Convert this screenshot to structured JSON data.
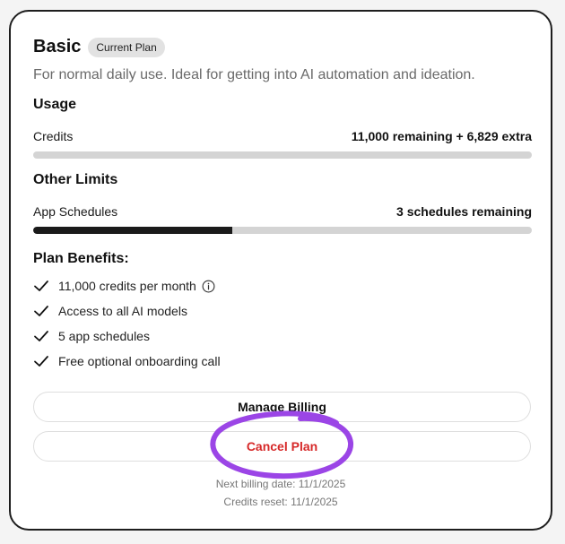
{
  "plan": {
    "name": "Basic",
    "badge": "Current Plan",
    "description": "For normal daily use. Ideal for getting into AI automation and ideation."
  },
  "usage": {
    "heading": "Usage",
    "label": "Credits",
    "value": "11,000 remaining + 6,829 extra",
    "used_fraction": 0
  },
  "other_limits": {
    "heading": "Other Limits",
    "label": "App Schedules",
    "value": "3 schedules remaining",
    "used_fraction": 0.4
  },
  "benefits": {
    "heading": "Plan Benefits:",
    "items": [
      "11,000 credits per month",
      "Access to all AI models",
      "5 app schedules",
      "Free optional onboarding call"
    ]
  },
  "buttons": {
    "manage_billing": "Manage Billing",
    "cancel_plan": "Cancel Plan"
  },
  "footer": {
    "next_billing": "Next billing date: 11/1/2025",
    "credits_reset": "Credits reset: 11/1/2025"
  },
  "colors": {
    "cancel_text": "#d62828",
    "highlight_circle": "#9b45e6",
    "bar_fill": "#1a1a1a",
    "bar_track": "#d4d4d4"
  },
  "icons": {
    "check": "check-icon",
    "info": "info-icon"
  }
}
